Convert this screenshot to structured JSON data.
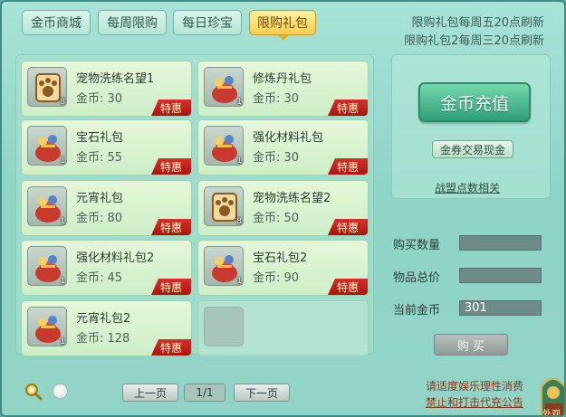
{
  "tabs": [
    {
      "label": "金币商城",
      "active": false
    },
    {
      "label": "每周限购",
      "active": false
    },
    {
      "label": "每日珍宝",
      "active": false
    },
    {
      "label": "限购礼包",
      "active": true
    }
  ],
  "notices": [
    "限购礼包每周五20点刷新",
    "限购礼包2每周三20点刷新"
  ],
  "items": [
    {
      "name": "宠物洗练名望1",
      "price": "金币: 30",
      "qty": "8",
      "badge": "特惠",
      "icon": "paw-scroll-icon"
    },
    {
      "name": "修炼丹礼包",
      "price": "金币: 30",
      "qty": "1",
      "badge": "特惠",
      "icon": "gift-bag-icon"
    },
    {
      "name": "宝石礼包",
      "price": "金币: 55",
      "qty": "1",
      "badge": "特惠",
      "icon": "gift-bag-icon"
    },
    {
      "name": "强化材料礼包",
      "price": "金币: 30",
      "qty": "1",
      "badge": "特惠",
      "icon": "gift-bag-icon"
    },
    {
      "name": "元宵礼包",
      "price": "金币: 80",
      "qty": "1",
      "badge": "特惠",
      "icon": "gift-bag-icon"
    },
    {
      "name": "宠物洗练名望2",
      "price": "金币: 50",
      "qty": "8",
      "badge": "特惠",
      "icon": "paw-scroll-icon"
    },
    {
      "name": "强化材料礼包2",
      "price": "金币: 45",
      "qty": "1",
      "badge": "特惠",
      "icon": "gift-bag-icon"
    },
    {
      "name": "宝石礼包2",
      "price": "金币: 90",
      "qty": "1",
      "badge": "特惠",
      "icon": "gift-bag-icon"
    },
    {
      "name": "元宵礼包2",
      "price": "金币: 128",
      "qty": "1",
      "badge": "特惠",
      "icon": "gift-bag-icon"
    }
  ],
  "right": {
    "topup_label": "金币充值",
    "exchange_label": "金券交易现金",
    "alliance_label": "战盟点数相关",
    "quantity_label": "购买数量",
    "quantity_value": "",
    "total_label": "物品总价",
    "total_value": "",
    "gold_label": "当前金币",
    "gold_value": "301",
    "buy_label": "购 买"
  },
  "pagination": {
    "prev_label": "上一页",
    "page": "1/1",
    "next_label": "下一页"
  },
  "footer": {
    "line1": "请适度娱乐理性消费",
    "line2": "禁止和打击代充公告"
  },
  "corner": {
    "label": "外观"
  },
  "colors": {
    "accent_tab": "#f5cc4a",
    "badge": "#c0221b",
    "topup": "#2f9f77",
    "background": "#92d5c6"
  }
}
